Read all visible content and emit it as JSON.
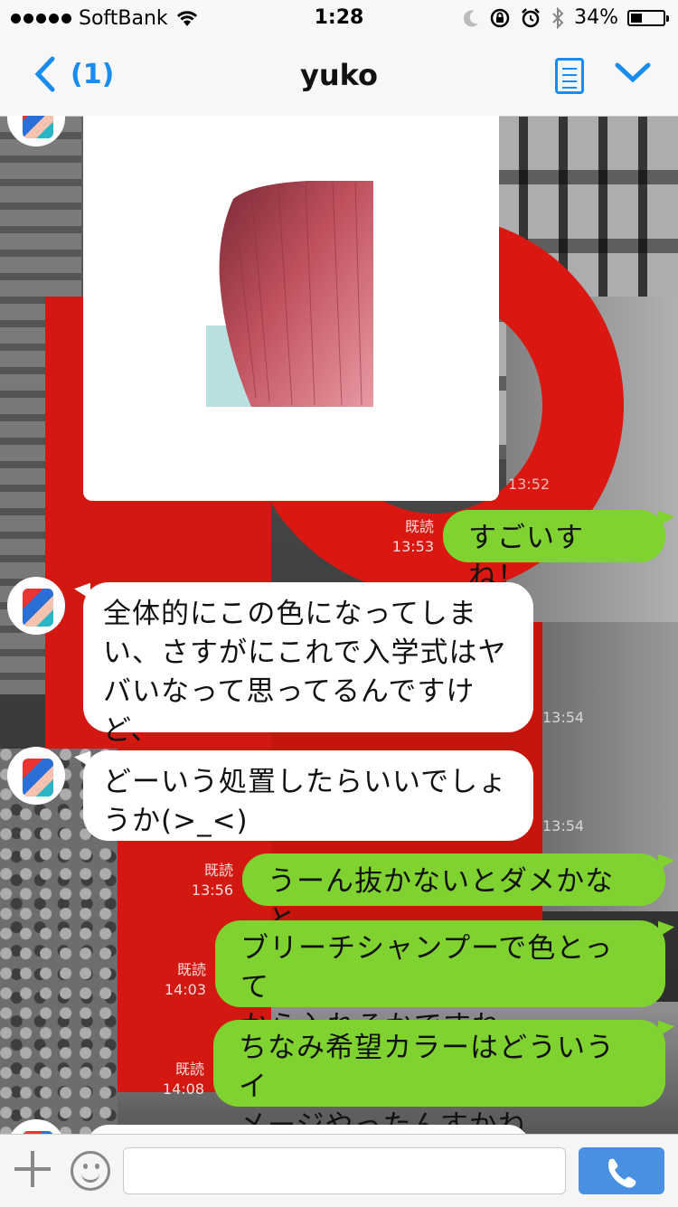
{
  "status_bar": {
    "carrier": "SoftBank",
    "time": "1:28",
    "battery": "34%",
    "battery_level": 0.34
  },
  "nav": {
    "back_count": "(1)",
    "title": "yuko",
    "notes_icon": "notes-icon",
    "menu_icon": "chevron-down-icon"
  },
  "messages": [
    {
      "from": "yuko",
      "type": "image",
      "time": "13:52"
    },
    {
      "from": "me",
      "text": "すごいすね！",
      "read": "既読",
      "time": "13:53"
    },
    {
      "from": "yuko",
      "lines": [
        "全体的にこの色になってしま",
        "い、さすがにこれで入学式はヤ",
        "バいなって思ってるんですけ",
        "ど、"
      ],
      "time": "13:54"
    },
    {
      "from": "yuko",
      "lines": [
        "どーいう処置したらいいでしょ",
        "うか(>_<)"
      ],
      "time": "13:54"
    },
    {
      "from": "me",
      "text": "うーん抜かないとダメかなと",
      "read": "既読",
      "time": "13:56"
    },
    {
      "from": "me",
      "lines": [
        "ブリーチシャンプーで色とって",
        "から入れるかですね"
      ],
      "read": "既読",
      "time": "14:03"
    },
    {
      "from": "me",
      "lines": [
        "ちなみ希望カラーはどういうイ",
        "メージやったんすかね"
      ],
      "read": "既読",
      "time": "14:08"
    }
  ],
  "input": {
    "placeholder": "",
    "plus_icon": "plus-icon",
    "emoji_icon": "emoji-icon",
    "call_icon": "phone-icon"
  },
  "colors": {
    "accent": "#1a8cf0",
    "outgoing_bubble": "#7fd22f",
    "incoming_bubble": "#ffffff",
    "call_button": "#4a90e2"
  }
}
